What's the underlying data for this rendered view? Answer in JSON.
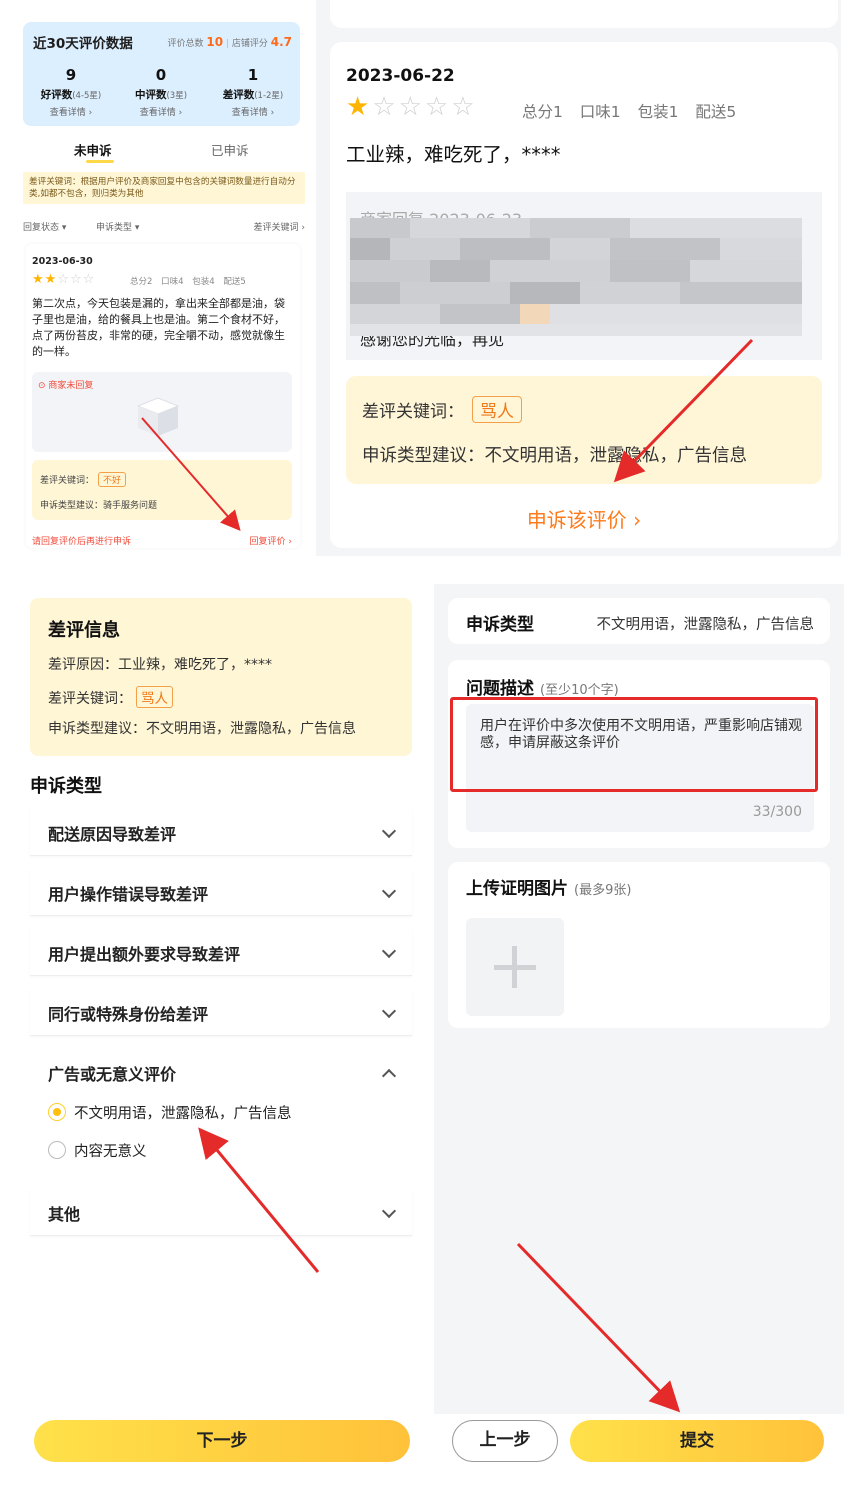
{
  "panel1": {
    "stats_title": "近30天评价数据",
    "total_label": "评价总数",
    "total_value": "10",
    "shop_score_label": "店铺评分",
    "shop_score_value": "4.7",
    "good": {
      "count": "9",
      "label": "好评数",
      "range": "(4-5星)",
      "link": "查看详情 ›"
    },
    "mid": {
      "count": "0",
      "label": "中评数",
      "range": "(3星)",
      "link": "查看详情 ›"
    },
    "bad": {
      "count": "1",
      "label": "差评数",
      "range": "(1-2星)",
      "link": "查看详情 ›"
    },
    "tab_unappealed": "未申诉",
    "tab_appealed": "已申诉",
    "keyword_note": "差评关键词：根据用户评价及商家回复中包含的关键词数量进行自动分类,如都不包含，则归类为其他",
    "filter_reply": "回复状态 ▾",
    "filter_type": "申诉类型 ▾",
    "filter_keyword": "差评关键词 ›",
    "review": {
      "date": "2023-06-30",
      "rating": 2,
      "scores": "总分2 口味4 包装4 配送5",
      "text": "第二次点，今天包装是漏的，拿出来全部都是油，袋子里也是油，给的餐具上也是油。第二个食材不好，点了两份苔皮，非常的硬，完全嚼不动，感觉就像生的一样。",
      "no_reply": "商家未回复",
      "keyword_label": "差评关键词：",
      "keyword_tag": "不好",
      "suggest": "申诉类型建议：骑手服务问题",
      "footer_left": "请回复评价后再进行申诉",
      "footer_right": "回复评价 ›"
    }
  },
  "panel2": {
    "date": "2023-06-22",
    "rating": 1,
    "scores": "总分1 口味1 包装1 配送5",
    "text": "工业辣，难吃死了，****",
    "reply_title": "商家回复 2023-06-23",
    "reply_tail": "感谢您的光临，再见",
    "keyword_label": "差评关键词：",
    "keyword_tag": "骂人",
    "suggest": "申诉类型建议：不文明用语，泄露隐私，广告信息",
    "appeal": "申诉该评价 ›"
  },
  "panel3": {
    "info_title": "差评信息",
    "reason": "差评原因：工业辣，难吃死了，****",
    "keyword_label": "差评关键词：",
    "keyword_tag": "骂人",
    "suggest": "申诉类型建议：不文明用语，泄露隐私，广告信息",
    "section_title": "申诉类型",
    "categories": [
      "配送原因导致差评",
      "用户操作错误导致差评",
      "用户提出额外要求导致差评",
      "同行或特殊身份给差评",
      "广告或无意义评价",
      "其他"
    ],
    "options": [
      "不文明用语，泄露隐私，广告信息",
      "内容无意义"
    ],
    "selected_option": 0,
    "next_button": "下一步"
  },
  "panel4": {
    "type_label": "申诉类型",
    "type_value": "不文明用语，泄露隐私，广告信息",
    "desc_label": "问题描述",
    "desc_hint": "(至少10个字)",
    "desc_text": "用户在评价中多次使用不文明用语，严重影响店铺观感，申请屏蔽这条评价",
    "desc_count": "33/300",
    "upload_label": "上传证明图片",
    "upload_hint": "(最多9张)",
    "prev_button": "上一步",
    "submit_button": "提交"
  },
  "colors": {
    "accent_yellow": "#ffc23a",
    "orange": "#ff7a1a",
    "red": "#e52a2a",
    "star": "#ffb400"
  }
}
